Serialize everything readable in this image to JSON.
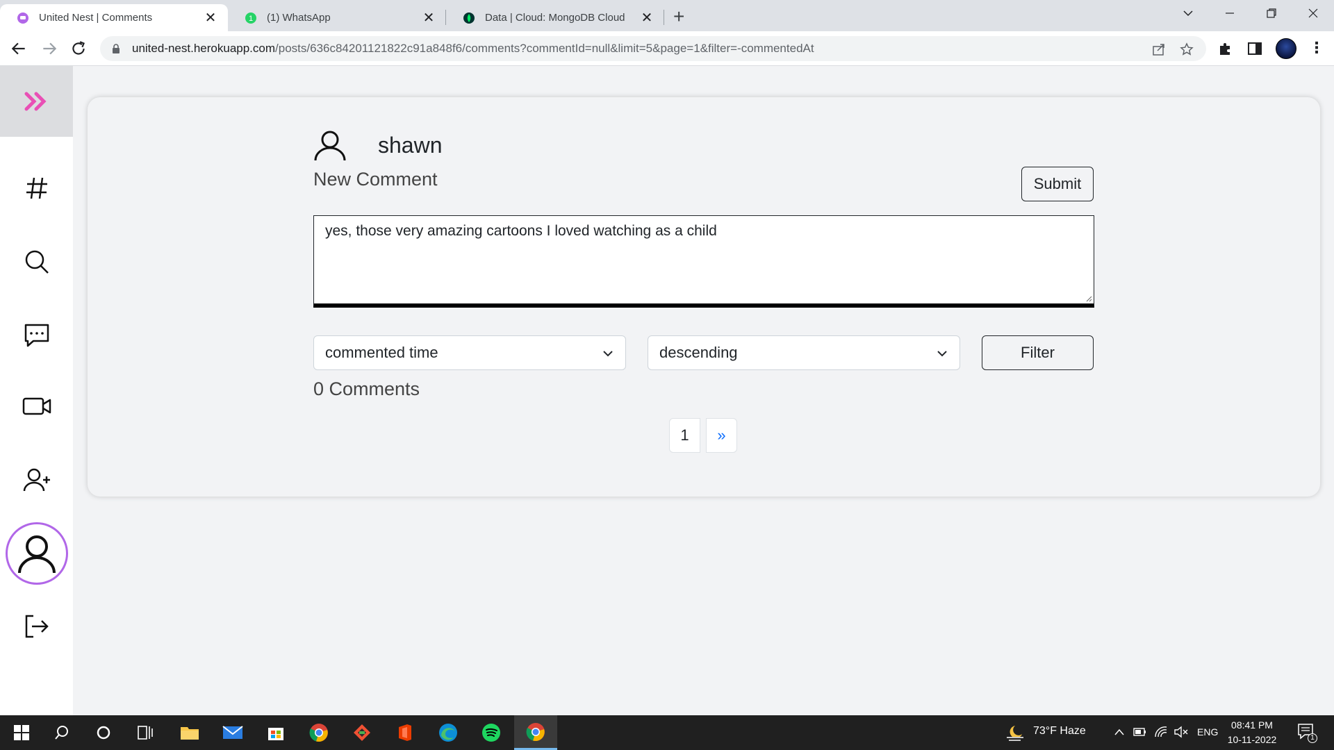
{
  "browser": {
    "tabs": [
      {
        "title": "United Nest | Comments",
        "active": true
      },
      {
        "title": "(1) WhatsApp",
        "active": false
      },
      {
        "title": "Data | Cloud: MongoDB Cloud",
        "active": false
      }
    ],
    "url_host": "united-nest.herokuapp.com",
    "url_path": "/posts/636c84201121822c91a848f6/comments?commentId=null&limit=5&page=1&filter=-commentedAt",
    "close_glyph": "✕",
    "newtab_glyph": "+"
  },
  "sidebar": {
    "items": [
      "expand-icon",
      "hashtag-icon",
      "search-icon",
      "chat-icon",
      "video-icon",
      "add-user-icon",
      "profile-icon",
      "logout-icon"
    ]
  },
  "comment_form": {
    "username": "shawn",
    "title": "New Comment",
    "submit_label": "Submit",
    "comment_text": "yes, those very amazing cartoons I loved watching as a child"
  },
  "filters": {
    "sort_field": "commented time",
    "sort_order": "descending",
    "filter_label": "Filter"
  },
  "comments": {
    "count_label": "0 Comments"
  },
  "pagination": {
    "current_page": "1",
    "next_label": "»"
  },
  "taskbar": {
    "weather": "73°F  Haze",
    "language": "ENG",
    "time": "08:41 PM",
    "date": "10-11-2022",
    "notification_count": "1"
  },
  "colors": {
    "brand_accent": "#e94fb5",
    "profile_ring": "#b167e8",
    "pager_next": "#0d6efd"
  }
}
